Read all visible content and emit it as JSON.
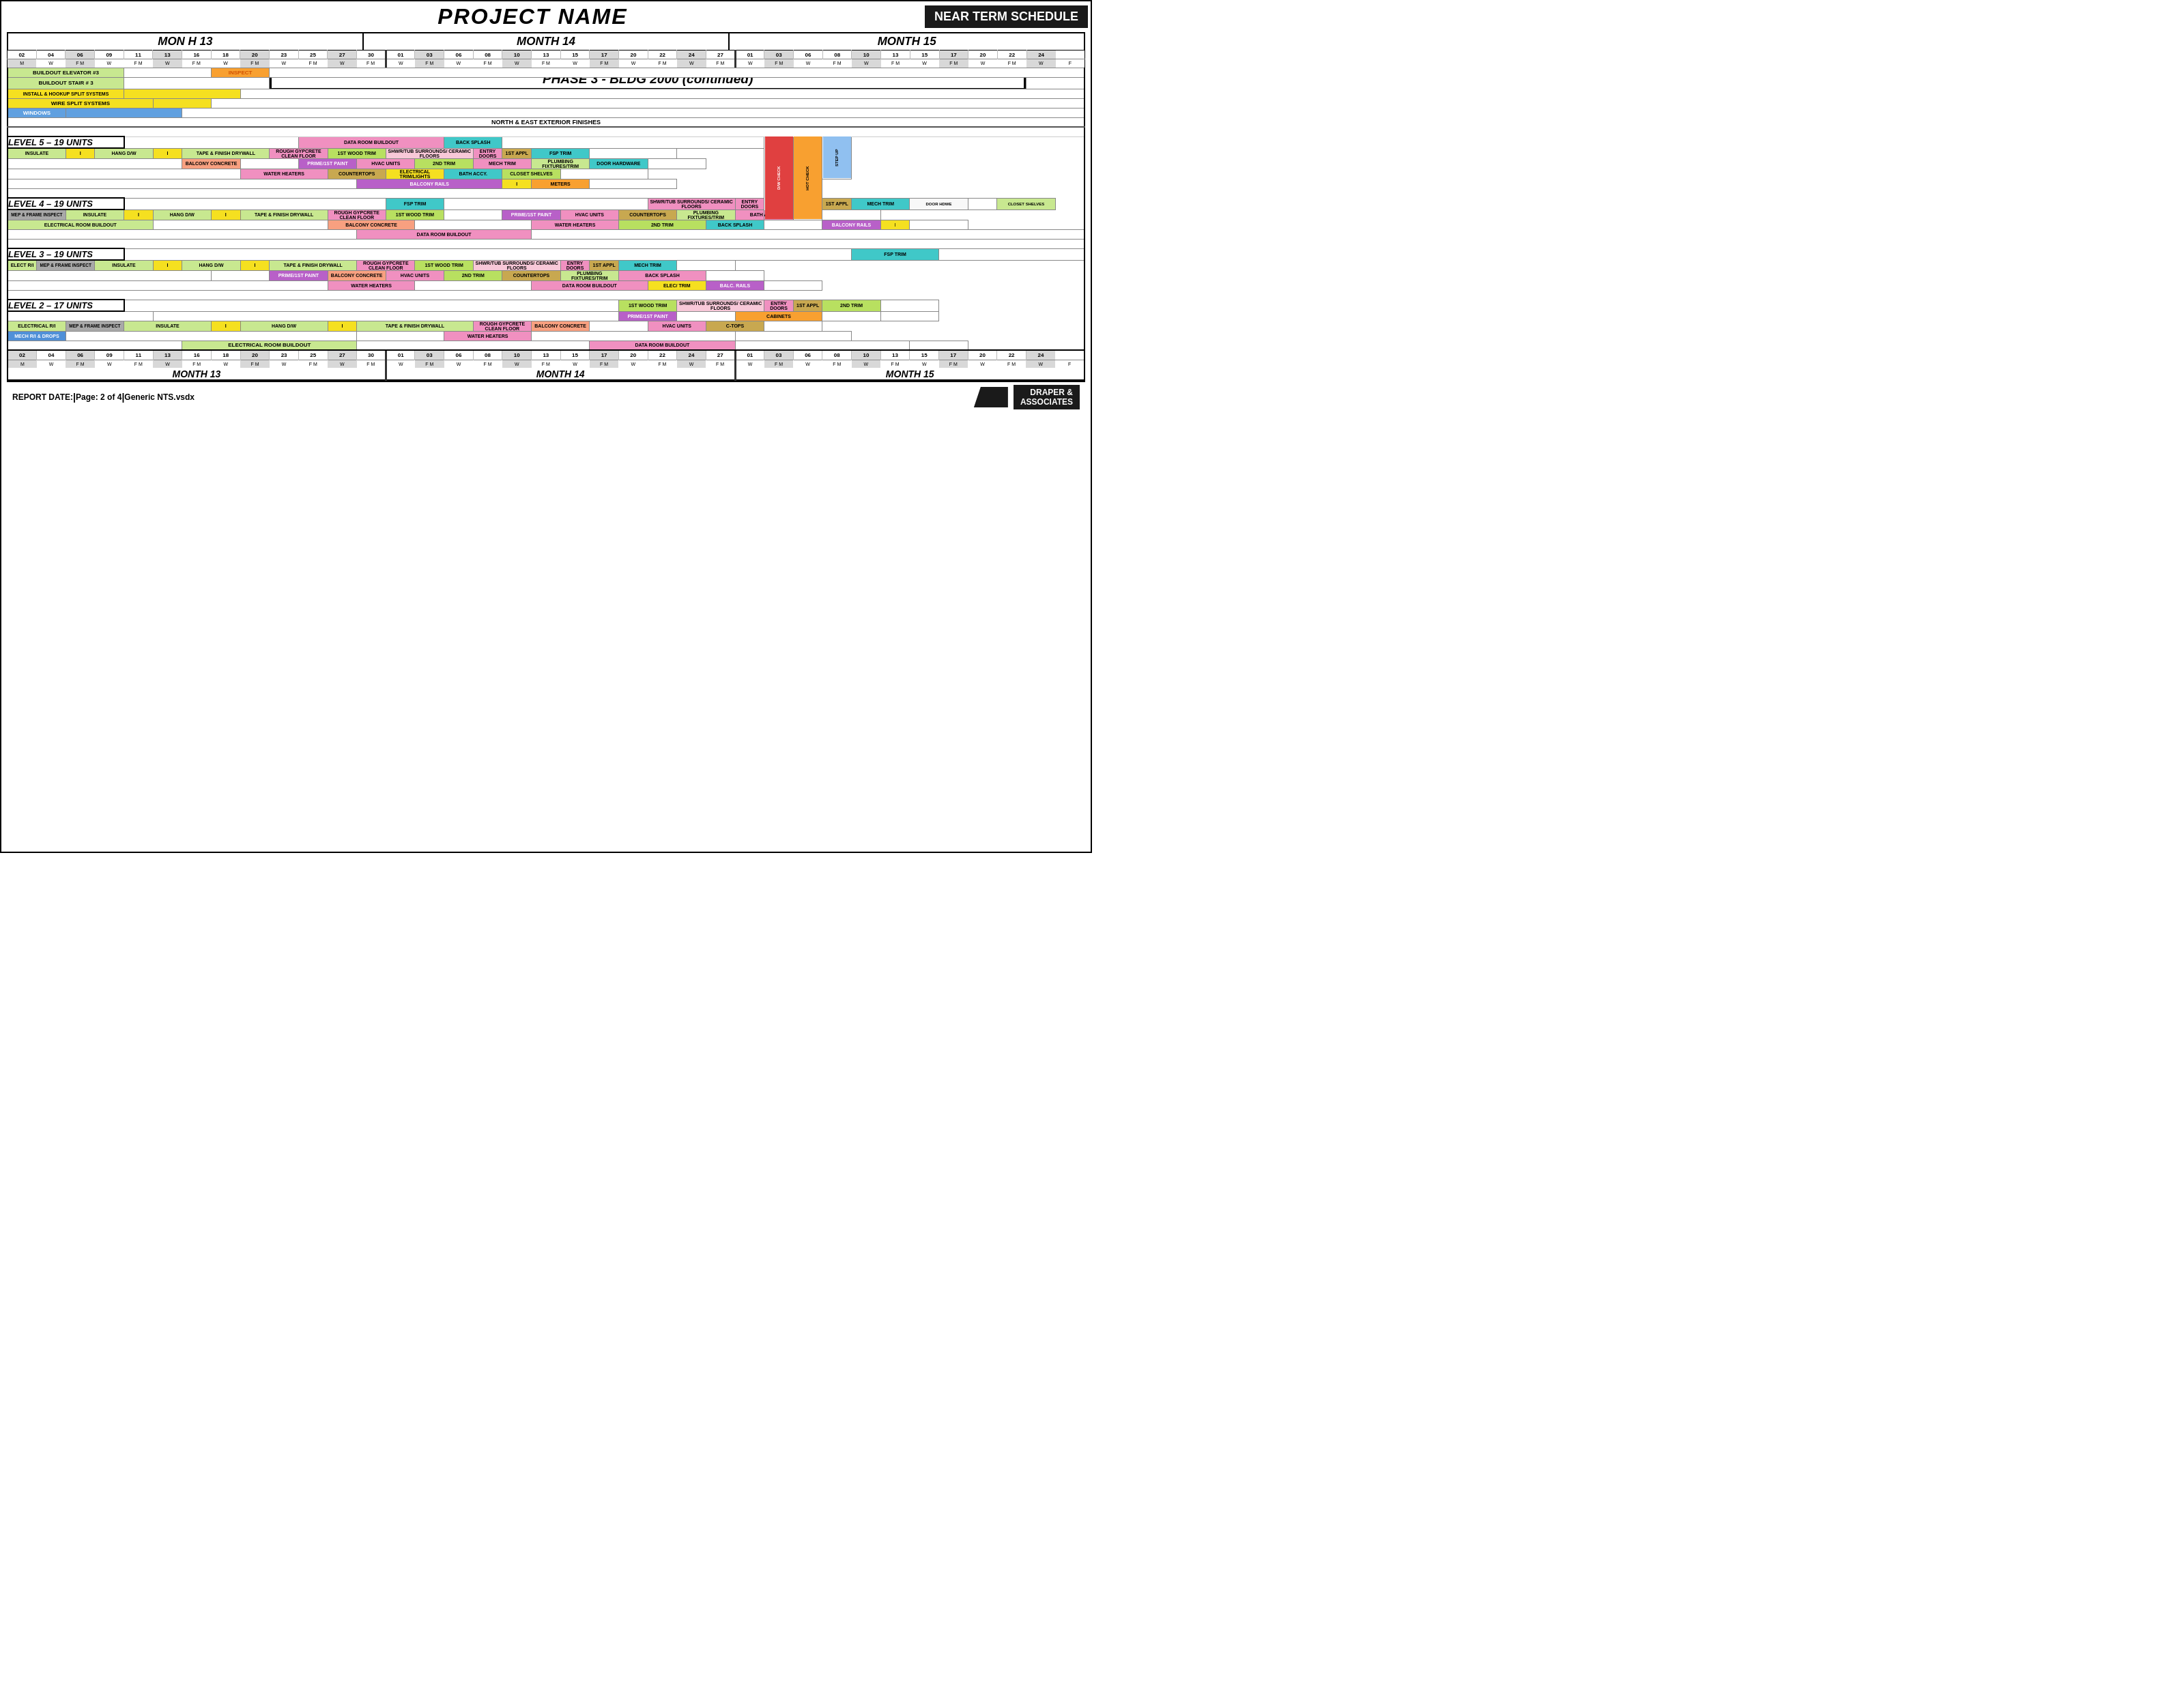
{
  "page": {
    "title": "PROJECT NAME",
    "nts_label": "NEAR TERM SCHEDULE",
    "months": [
      {
        "label": "MONTH 13",
        "short": "MON  H 13"
      },
      {
        "label": "MONTH 14"
      },
      {
        "label": "MONTH 15"
      }
    ],
    "footer": {
      "report_date_label": "REPORT DATE:",
      "report_date_value": "",
      "page_label": "Page: 2 of 4",
      "file_label": "Generic NTS.vsdx",
      "company_line1": "DRAPER &",
      "company_line2": "ASSOCIATES"
    }
  },
  "sections": {
    "phase_banner": "PHASE 3 - BLDG 2000 (continued)",
    "top_tasks": [
      {
        "label": "BUILDOUT ELEVATOR #3",
        "inspect": "INSPECT"
      },
      {
        "label": "BUILDOUT STAIR # 3"
      },
      {
        "label": "INSTALL & HOOKUP SPLIT SYSTEMS"
      },
      {
        "label": "WIRE SPLIT SYSTEMS"
      },
      {
        "label": "WINDOWS"
      },
      {
        "label": "NORTH & EAST EXTERIOR FINISHES"
      }
    ],
    "levels": [
      {
        "name": "LEVEL 5 – 19 UNITS",
        "tasks": [
          "DATA ROOM BUILDOUT",
          "INSULATE",
          "HANG D/W",
          "TAPE & FINISH DRYWALL",
          "ROUGH GYPCRETE CLEAN FLOOR",
          "1ST WOOD TRIM",
          "SHWR/TUB SURROUNDS/CERAMIC FLOORS",
          "ENTRY DOORS",
          "1ST APPL",
          "FSP TRIM",
          "PRIME/1ST PAINT",
          "BALCONY CONCRETE",
          "HVAC UNITS",
          "2ND TRIM",
          "WATER HEATERS",
          "MECH TRIM",
          "COUNTERTOPS",
          "PLUMBING FIXTURES/TRIM",
          "BATH ACCY.",
          "ELECTRICAL TRIM/LIGHTS",
          "DOOR HARDWARE",
          "CLOSET SHELVES",
          "BALCONY RAILS",
          "BACK SPLASH",
          "METERS"
        ]
      },
      {
        "name": "LEVEL 4 – 19 UNITS",
        "tasks": [
          "MEP & FRAME INSPECT",
          "INSULATE",
          "HANG D/W",
          "TAPE & FINISH DRYWALL",
          "ROUGH GYPCRETE CLEAN FLOOR",
          "1ST WOOD TRIM",
          "SHWR/TUB SURROUNDS/CERAMIC FLOORS",
          "ENTRY DOORS",
          "1ST APPL",
          "FSP TRIM",
          "PRIME/1ST PAINT",
          "BALCONY CONCRETE",
          "HVAC UNITS",
          "2ND TRIM",
          "WATER HEATERS",
          "COUNTERTOPS",
          "MECH TRIM",
          "PLUMBING FIXTURES/TRIM",
          "BATH ACCY.",
          "DOOR HARDWARE",
          "CLOSET SHELVES",
          "BALCONY RAILS",
          "BACK SPLASH",
          "DATA ROOM BUILDOUT",
          "ELECTRICAL ROOM BUILDOUT"
        ]
      },
      {
        "name": "LEVEL 3 – 19 UNITS",
        "tasks": [
          "ELECT R/I",
          "MEP & FRAME INSPECT",
          "INSULATE",
          "HANG D/W",
          "TAPE & FINISH DRYWALL",
          "ROUGH GYPCRETE CLEAN FLOOR",
          "1ST WOOD TRIM",
          "SHWR/TUB SURROUNDS/CERAMIC FLOORS",
          "ENTRY DOORS",
          "1ST APPL",
          "FSP TRIM",
          "PRIME/1ST PAINT",
          "BALCONY CONCRETE",
          "HVAC UNITS",
          "2ND TRIM",
          "WATER HEATERS",
          "COUNTERTOPS",
          "PLUMBING FIXTURES/TRIM",
          "MECH TRIM",
          "DATA ROOM BUILDOUT",
          "BALCONY RAILS",
          "ELEC/TRIM",
          "BACK SPLASH"
        ]
      },
      {
        "name": "LEVEL 2 – 17 UNITS",
        "tasks": [
          "ELECTRICAL R/I",
          "MEP & FRAME INSPECT",
          "INSULATE",
          "HANG D/W",
          "TAPE & FINISH DRYWALL",
          "ROUGH GYPCRETE CLEAN FLOOR",
          "1ST WOOD TRIM",
          "SHWR/TUB SURROUNDS/CERAMIC FLOORS",
          "ENTRY DOORS",
          "1ST APPL",
          "BALCONY CONCRETE",
          "HVAC UNITS",
          "2ND TRIM",
          "WATER HEATERS",
          "CABINETS",
          "C-TOPS",
          "DATA ROOM BUILDOUT",
          "ELECTRICAL ROOM BUILDOUT",
          "MECH R/I & DROPS"
        ]
      }
    ]
  }
}
